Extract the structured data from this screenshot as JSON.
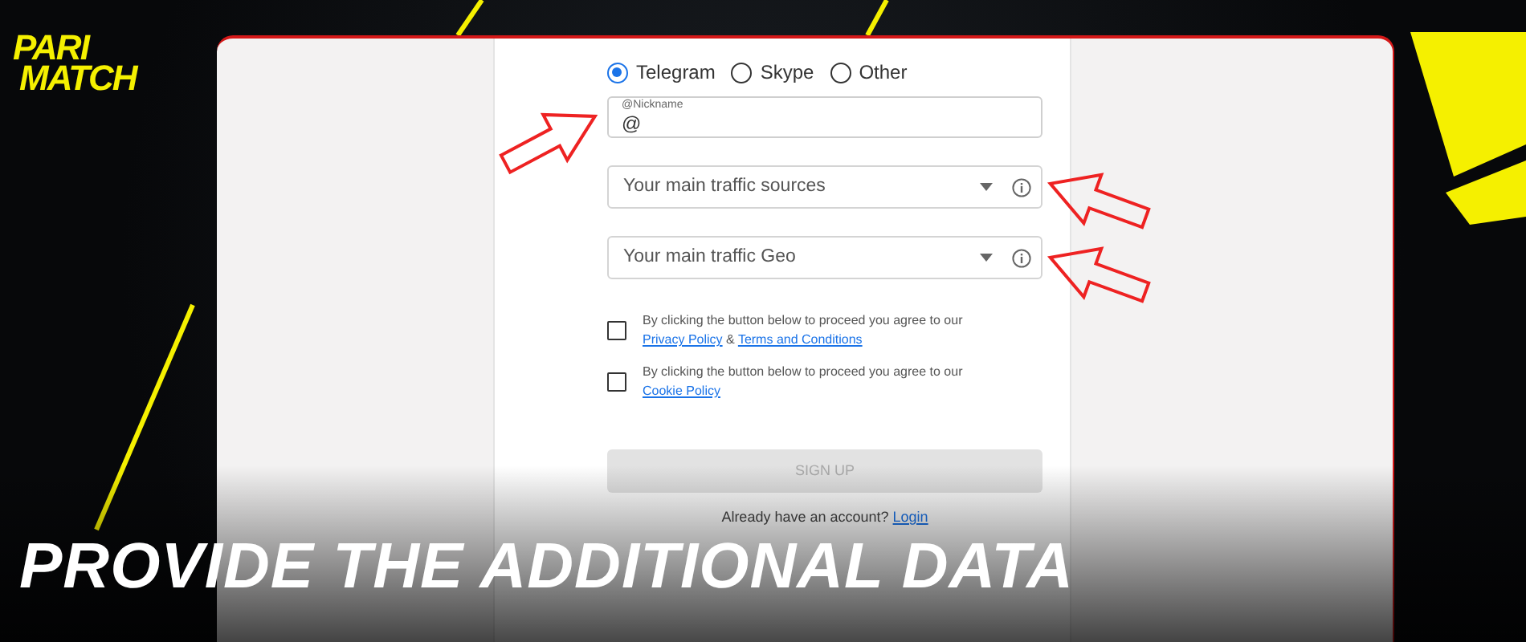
{
  "logo": {
    "line_1": "PARI",
    "line_2": "MATCH"
  },
  "form": {
    "contact_options": [
      {
        "label": "Telegram",
        "selected": true
      },
      {
        "label": "Skype",
        "selected": false
      },
      {
        "label": "Other",
        "selected": false
      }
    ],
    "nickname": {
      "label": "@Nickname",
      "value": "@"
    },
    "selects": [
      {
        "placeholder": "Your main traffic sources"
      },
      {
        "placeholder": "Your main traffic Geo"
      }
    ],
    "agreements": [
      {
        "checked": false,
        "parts": [
          {
            "kind": "text",
            "text": "By clicking the button below to proceed you agree to our "
          },
          {
            "kind": "link",
            "text": "Privacy Policy"
          },
          {
            "kind": "text",
            "text": " & "
          },
          {
            "kind": "link",
            "text": "Terms and Conditions"
          }
        ]
      },
      {
        "checked": false,
        "parts": [
          {
            "kind": "text",
            "text": "By clicking the button below to proceed you agree to our "
          },
          {
            "kind": "link",
            "text": "Cookie Policy"
          }
        ]
      }
    ],
    "signup_button": {
      "label": "SIGN UP",
      "disabled": true
    },
    "login_prompt": {
      "text": "Already have an account?",
      "link": "Login"
    }
  },
  "caption": "PROVIDE THE ADDITIONAL DATA"
}
